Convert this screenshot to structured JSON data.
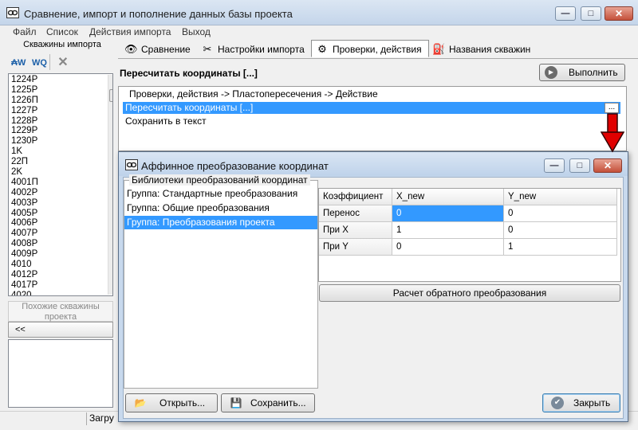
{
  "window": {
    "title": "Сравнение, импорт и пополнение данных базы проекта",
    "minimize": "—",
    "maximize": "□",
    "close": "✕"
  },
  "menu": [
    "Файл",
    "Список",
    "Действия импорта",
    "Выход"
  ],
  "left_panel": {
    "header": "Скважины импорта",
    "wells": [
      "1224P",
      "1225P",
      "1226П",
      "1227P",
      "1228P",
      "1229P",
      "1230P",
      "1K",
      "22П",
      "2K",
      "4001П",
      "4002P",
      "4003P",
      "4005P",
      "4006P",
      "4007P",
      "4008P",
      "4009P",
      "4010",
      "4012P",
      "4017P",
      "4020"
    ],
    "similar_label": "Похожие скважины проекта",
    "collapse_label": "<<"
  },
  "tabs": [
    {
      "label": "Сравнение",
      "icon": "eye-icon",
      "active": false
    },
    {
      "label": "Настройки импорта",
      "icon": "tools-icon",
      "active": false
    },
    {
      "label": "Проверки, действия",
      "icon": "gear-icon",
      "active": true
    },
    {
      "label": "Названия скважин",
      "icon": "well-icon",
      "active": false
    }
  ],
  "checks_panel": {
    "title": "Пересчитать координаты [...]",
    "run_label": "Выполнить",
    "caption": "Проверки, действия -> Пластопересечения -> Действие",
    "actions": [
      "Пересчитать координаты [...]",
      "Сохранить в текст"
    ],
    "ellipsis": "..."
  },
  "status": {
    "text": "Загру"
  },
  "dialog": {
    "title": "Аффинное преобразование координат",
    "libs_caption": "Библиотеки преобразований координат",
    "libraries": [
      "Группа: Стандартные преобразования",
      "Группа: Общие преобразования",
      "Группа: Преобразования проекта"
    ],
    "selected_library": 2,
    "grid": {
      "columns": [
        "Коэффициент",
        "X_new",
        "Y_new"
      ],
      "rows": [
        [
          "Перенос",
          "0",
          "0"
        ],
        [
          "При X",
          "1",
          "0"
        ],
        [
          "При Y",
          "0",
          "1"
        ]
      ]
    },
    "calc_label": "Расчет обратного преобразования",
    "open_label": "Открыть...",
    "save_label": "Сохранить...",
    "close_label": "Закрыть"
  },
  "colors": {
    "selection": "#3399ff",
    "arrow": "#e00000"
  }
}
